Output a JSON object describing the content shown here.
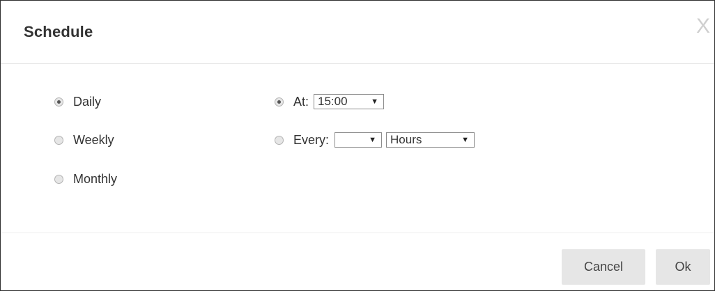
{
  "dialog": {
    "title": "Schedule",
    "close_label": "X"
  },
  "frequency": {
    "options": [
      {
        "label": "Daily",
        "checked": true
      },
      {
        "label": "Weekly",
        "checked": false
      },
      {
        "label": "Monthly",
        "checked": false
      }
    ]
  },
  "timing": {
    "at_label": "At:",
    "at_value": "15:00",
    "at_checked": true,
    "every_label": "Every:",
    "every_value": "",
    "every_unit": "Hours",
    "every_checked": false,
    "dropdown_arrow": "▼"
  },
  "footer": {
    "cancel_label": "Cancel",
    "ok_label": "Ok"
  }
}
